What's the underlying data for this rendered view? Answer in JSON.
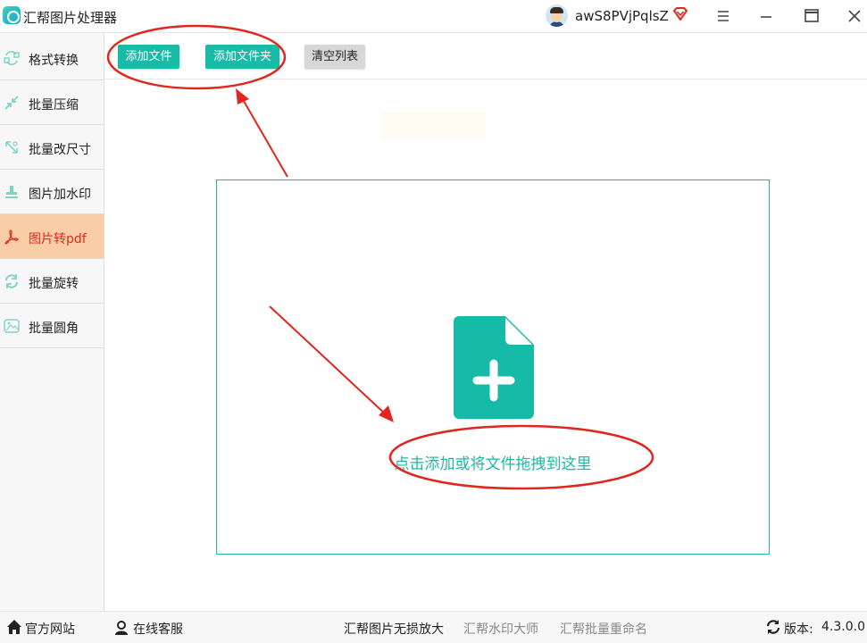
{
  "app": {
    "title": "汇帮图片处理器"
  },
  "user": {
    "name": "awS8PVjPqlsZ"
  },
  "sidebar": {
    "items": [
      {
        "label": "格式转换",
        "icon": "format-convert-icon"
      },
      {
        "label": "批量压缩",
        "icon": "compress-icon"
      },
      {
        "label": "批量改尺寸",
        "icon": "resize-icon"
      },
      {
        "label": "图片加水印",
        "icon": "watermark-icon"
      },
      {
        "label": "图片转pdf",
        "icon": "pdf-icon",
        "active": true
      },
      {
        "label": "批量旋转",
        "icon": "rotate-icon"
      },
      {
        "label": "批量圆角",
        "icon": "round-corner-icon"
      }
    ]
  },
  "toolbar": {
    "add_file": "添加文件",
    "add_folder": "添加文件夹",
    "clear_list": "清空列表"
  },
  "dropzone": {
    "text": "点击添加或将文件拖拽到这里"
  },
  "statusbar": {
    "website": "官方网站",
    "support": "在线客服",
    "link1": "汇帮图片无损放大",
    "link2": "汇帮水印大师",
    "link3": "汇帮批量重命名",
    "version_label": "版本:",
    "version": "4.3.0.0"
  },
  "colors": {
    "accent": "#17bca7",
    "active_bg": "#f9cda6",
    "active_text": "#e8261e",
    "annotation": "#e0271e"
  }
}
